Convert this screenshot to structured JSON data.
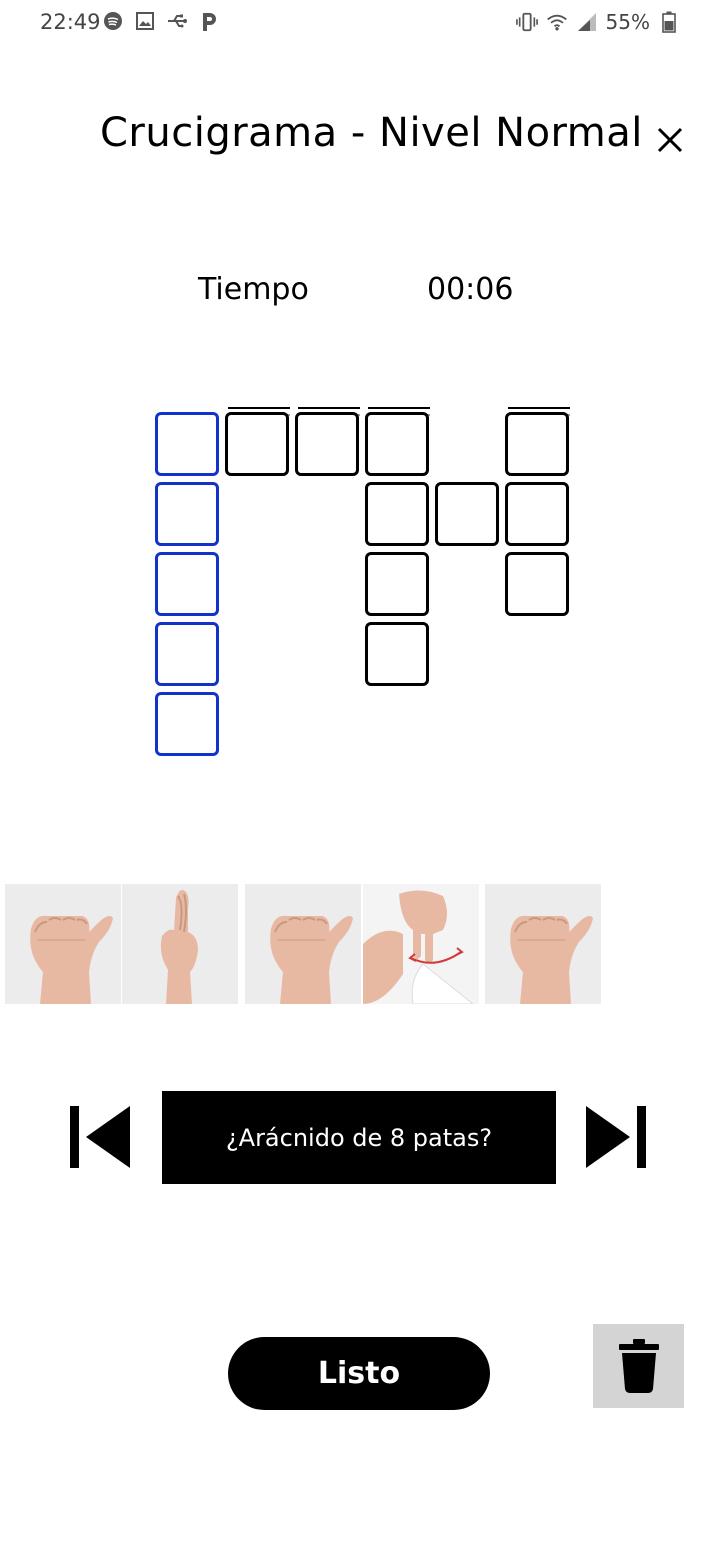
{
  "status_bar": {
    "time": "22:49",
    "left_icons": [
      "spotify-icon",
      "image-icon",
      "usb-icon",
      "parking-icon"
    ],
    "right_icons": [
      "vibrate-icon",
      "wifi-icon",
      "signal-icon",
      "battery-icon"
    ],
    "battery": "55%"
  },
  "header": {
    "title": "Crucigrama - Nivel Normal",
    "close_icon": "close-icon"
  },
  "timer": {
    "label": "Tiempo",
    "value": "00:06"
  },
  "crossword": {
    "active_color": "#1133cc",
    "border_color": "#000000"
  },
  "signs": {
    "images": [
      "sign-a-hand",
      "sign-r-hand",
      "sign-a-hand",
      "sign-n-hand",
      "sign-a-hand"
    ]
  },
  "navigation": {
    "prev_icon": "skip-previous-icon",
    "next_icon": "skip-next-icon",
    "clue": "¿Arácnido de 8 patas?"
  },
  "actions": {
    "done_label": "Listo",
    "delete_icon": "trash-icon"
  }
}
